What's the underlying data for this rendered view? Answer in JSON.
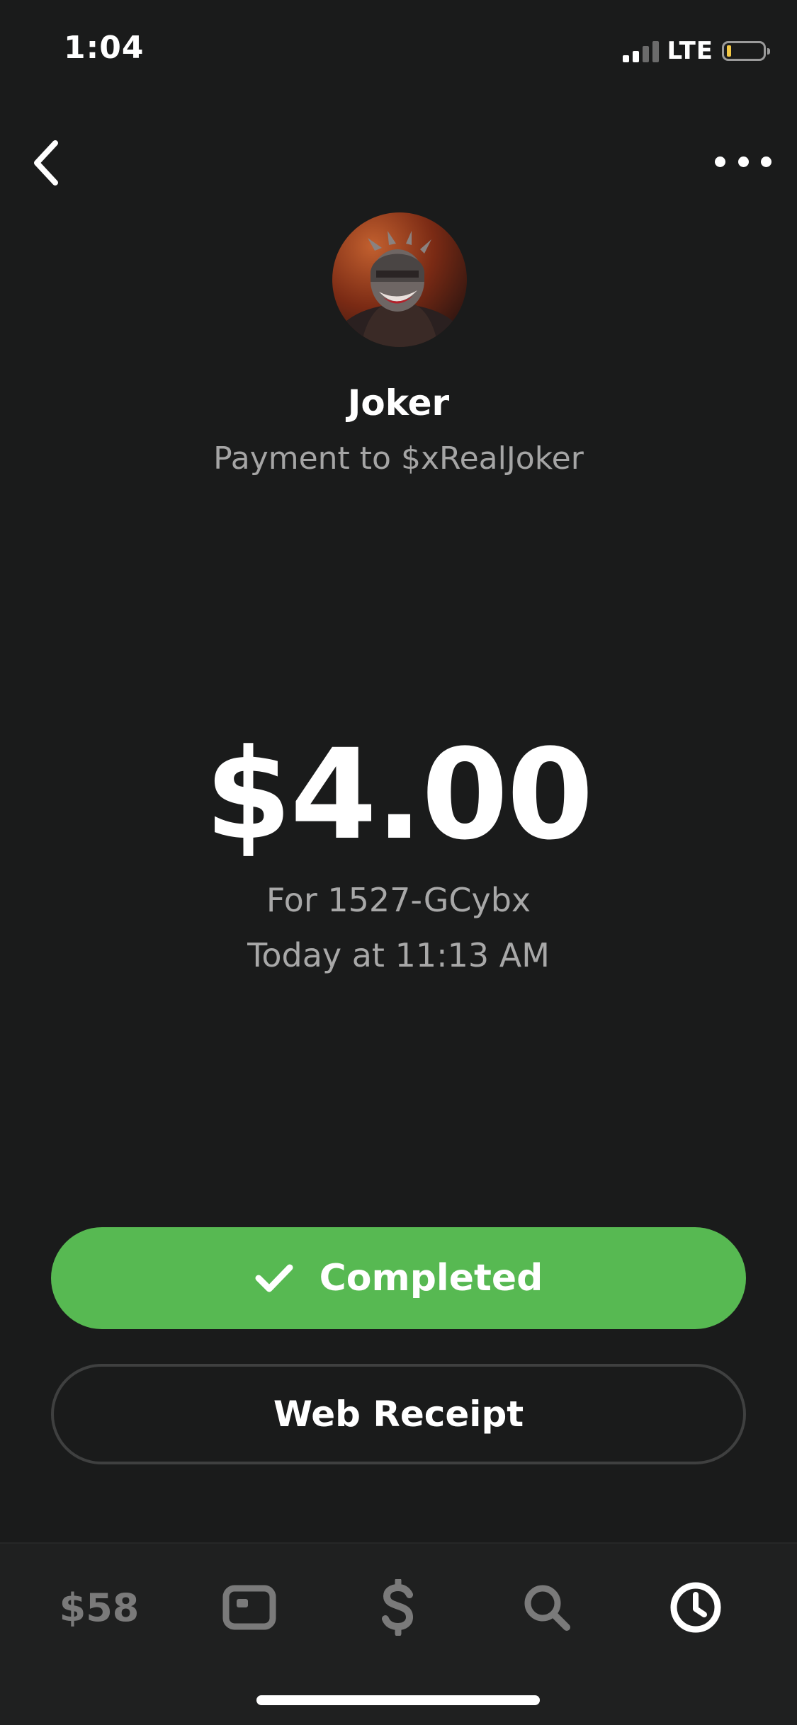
{
  "status_bar": {
    "time": "1:04",
    "network": "LTE"
  },
  "nav": {
    "back_icon": "chevron-left-icon",
    "more_icon": "more-horizontal-icon"
  },
  "recipient": {
    "avatar": "avatar",
    "name": "Joker",
    "subtitle": "Payment to $xRealJoker"
  },
  "payment": {
    "amount": "$4.00",
    "note": "For 1527-GCybx",
    "date": "Today at 11:13 AM"
  },
  "actions": {
    "status_label": "Completed",
    "status_icon": "checkmark-icon",
    "receipt_label": "Web Receipt"
  },
  "tab_bar": {
    "balance_label": "$58",
    "items": [
      {
        "name": "balance",
        "icon": "balance-text"
      },
      {
        "name": "card",
        "icon": "card-icon"
      },
      {
        "name": "pay",
        "icon": "dollar-icon"
      },
      {
        "name": "search",
        "icon": "search-icon"
      },
      {
        "name": "activity",
        "icon": "clock-icon",
        "active": true
      }
    ]
  },
  "colors": {
    "background": "#1a1b1b",
    "accent_green": "#57b952",
    "muted_text": "#a5a5a5",
    "inactive_tab": "#7a7a7a"
  }
}
